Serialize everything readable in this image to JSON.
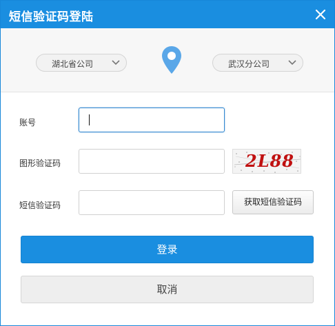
{
  "window": {
    "title": "短信验证码登陆",
    "close_icon": "close-icon"
  },
  "region": {
    "left_select": {
      "value": "湖北省公司",
      "icon": "chevron-down-icon"
    },
    "right_select": {
      "value": "武汉分公司",
      "icon": "chevron-down-icon"
    },
    "pin_icon": "location-pin-icon",
    "pin_color": "#5aa7e8"
  },
  "form": {
    "account": {
      "label": "账号",
      "value": ""
    },
    "graphic_code": {
      "label": "图形验证码",
      "value": "",
      "captcha_text": "2L88"
    },
    "sms_code": {
      "label": "短信验证码",
      "value": "",
      "button_label": "获取短信验证码"
    }
  },
  "actions": {
    "login_label": "登录",
    "cancel_label": "取消"
  },
  "colors": {
    "accent": "#1a8ee0",
    "captcha_text": "#c01010"
  }
}
